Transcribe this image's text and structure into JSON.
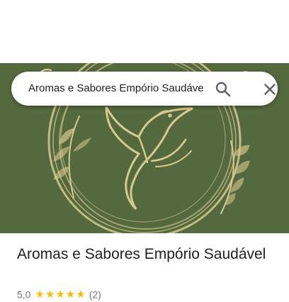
{
  "search": {
    "query": "Aromas e Sabores Empório Saudáve",
    "search_icon": "search-icon",
    "close_icon": "close-icon"
  },
  "hero": {
    "image": "hummingbird-logo",
    "background_color": "#55693f",
    "line_color": "#d8c98f"
  },
  "place": {
    "name": "Aromas e Sabores Empório Saudável",
    "rating": "5,0",
    "stars": "★★★★★",
    "review_count": "(2)",
    "star_color": "#fbbc04"
  }
}
